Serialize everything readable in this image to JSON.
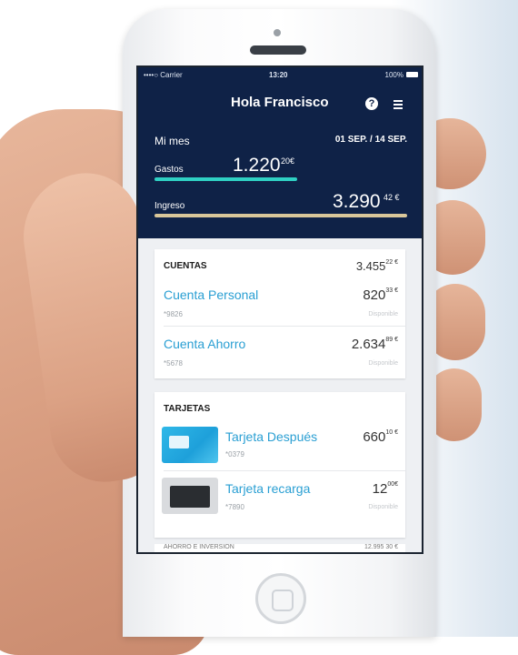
{
  "status": {
    "carrier": "••••○ Carrier",
    "time": "13:20",
    "battery": "100%"
  },
  "header": {
    "greeting": "Hola Francisco"
  },
  "summary": {
    "month_label": "Mi mes",
    "range": "01 SEP. / 14 SEP.",
    "gastos": {
      "label": "Gastos",
      "amount": "1.220",
      "decimals": "20€"
    },
    "ingreso": {
      "label": "Ingreso",
      "amount": "3.290",
      "decimals": "42 €"
    }
  },
  "cuentas": {
    "title": "CUENTAS",
    "total": "3.455",
    "total_dec": "22 €",
    "items": [
      {
        "name": "Cuenta Personal",
        "number": "*9826",
        "amount": "820",
        "dec": "33 €",
        "status": "Disponible"
      },
      {
        "name": "Cuenta Ahorro",
        "number": "*5678",
        "amount": "2.634",
        "dec": "89 €",
        "status": "Disponible"
      }
    ]
  },
  "tarjetas": {
    "title": "TARJETAS",
    "items": [
      {
        "name": "Tarjeta Después",
        "number": "*0379",
        "amount": "660",
        "dec": "10 €",
        "status": ""
      },
      {
        "name": "Tarjeta recarga",
        "number": "*7890",
        "amount": "12",
        "dec": "00€",
        "status": "Disponible"
      }
    ]
  },
  "peek": {
    "left": "AHORRO E INVERSIÓN",
    "right": "12.995 30 €"
  }
}
